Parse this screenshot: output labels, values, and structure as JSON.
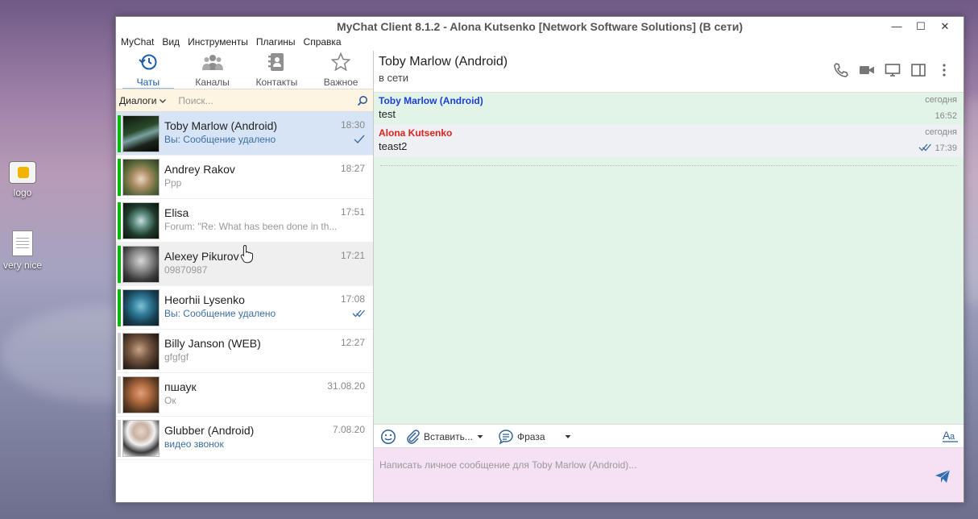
{
  "desktop": {
    "icons": [
      {
        "label": "logo",
        "icon": "logo-app-icon"
      },
      {
        "label": "very nice",
        "icon": "text-file-icon"
      }
    ]
  },
  "window": {
    "title": "MyChat Client 8.1.2 - Alona Kutsenko [Network Software Solutions] (В сети)",
    "controls": {
      "minimize": "—",
      "maximize": "☐",
      "close": "✕"
    }
  },
  "menu": [
    "MyChat",
    "Вид",
    "Инструменты",
    "Плагины",
    "Справка"
  ],
  "nav": [
    {
      "label": "Чаты",
      "icon": "history-icon",
      "active": true
    },
    {
      "label": "Каналы",
      "icon": "group-icon",
      "active": false
    },
    {
      "label": "Контакты",
      "icon": "address-book-icon",
      "active": false
    },
    {
      "label": "Важное",
      "icon": "star-icon",
      "active": false
    }
  ],
  "filter": {
    "dropdown": "Диалоги",
    "placeholder": "Поиск..."
  },
  "dialogs": [
    {
      "name": "Toby Marlow (Android)",
      "time": "18:30",
      "preview": "Вы: Сообщение удалено",
      "online": true,
      "check": "single",
      "state": "active"
    },
    {
      "name": "Andrey Rakov",
      "time": "18:27",
      "preview": "Ppp",
      "online": true
    },
    {
      "name": "Elisa",
      "time": "17:51",
      "preview": "Forum: \"Re: What has been done in th...",
      "online": true
    },
    {
      "name": "Alexey Pikurov",
      "time": "17:21",
      "preview": "09870987",
      "online": true,
      "state": "hover"
    },
    {
      "name": "Heorhii Lysenko",
      "time": "17:08",
      "preview": "Вы: Сообщение удалено",
      "online": true,
      "check": "double"
    },
    {
      "name": "Billy Janson (WEB)",
      "time": "12:27",
      "preview": "gfgfgf",
      "online": false
    },
    {
      "name": "пшаук",
      "time": "31.08.20",
      "preview": "Ок",
      "online": false
    },
    {
      "name": "Glubber (Android)",
      "time": "7.08.20",
      "preview": "видео звонок",
      "online": false
    }
  ],
  "chat": {
    "name": "Toby Marlow (Android)",
    "status": "в сети",
    "tools": [
      "phone-icon",
      "video-camera-icon",
      "screen-share-icon",
      "side-panel-icon",
      "more-vertical-icon"
    ],
    "messages": [
      {
        "author": "Toby Marlow (Android)",
        "author_color": "#1a3fd6",
        "text": "test",
        "day": "сегодня",
        "time": "16:52"
      },
      {
        "author": "Alona Kutsenko",
        "author_color": "#e0201a",
        "text": "teast2",
        "day": "сегодня",
        "time": "17:39",
        "read": true
      }
    ],
    "toolbar": {
      "insert": "Вставить...",
      "phrase": "Фраза",
      "font_icon": "font-size-icon"
    },
    "composer_placeholder": "Написать личное сообщение для Toby Marlow (Android)..."
  }
}
